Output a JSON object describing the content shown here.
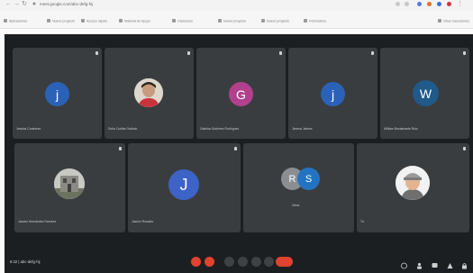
{
  "browser": {
    "url": "meet.google.com/abc-defg-hij",
    "bookmarks": [
      "Aplicaciones",
      "Nuevo proyecto",
      "Acceso rápido",
      "Material de Apoyo",
      "Classroom",
      "Nuevo proyecto",
      "Nuevo proyecto",
      "Formularios"
    ],
    "other_bookmarks": "Otros marcadores"
  },
  "participants": [
    {
      "name": "Jessica Contreras",
      "initial": "j",
      "color": "#2a62b8"
    },
    {
      "name": "Sofía Cuéllar Galindo",
      "initial": "",
      "color": "#8a7a6a",
      "photo": "person"
    },
    {
      "name": "Galdina Gutiérrez Rodríguez",
      "initial": "G",
      "color": "#b1418c"
    },
    {
      "name": "Jimena Jaimes",
      "initial": "j",
      "color": "#2a62b8"
    },
    {
      "name": "William Bustamante Ruiz",
      "initial": "W",
      "color": "#1f5a8a"
    },
    {
      "name": "Jacobo Hernández Ramírez",
      "initial": "",
      "color": "#8c8c8c",
      "photo": "building"
    },
    {
      "name": "Jazmín Rosales",
      "initial": "J",
      "color": "#3e63c6"
    },
    {
      "name": "",
      "initial": "",
      "group": [
        "R",
        "S"
      ],
      "group_colors": [
        "#8b8f93",
        "#2473c2"
      ]
    },
    {
      "name": "Tú",
      "initial": "",
      "color": "#b8b8b8",
      "photo": "cartoon"
    }
  ],
  "group_tile_label": "Otros",
  "meeting": {
    "time_code": "6:32 | abc-defg-hij"
  },
  "colors": {
    "background": "#1c1f21",
    "tile": "#3a3d3f",
    "hangup": "#e0432f"
  }
}
